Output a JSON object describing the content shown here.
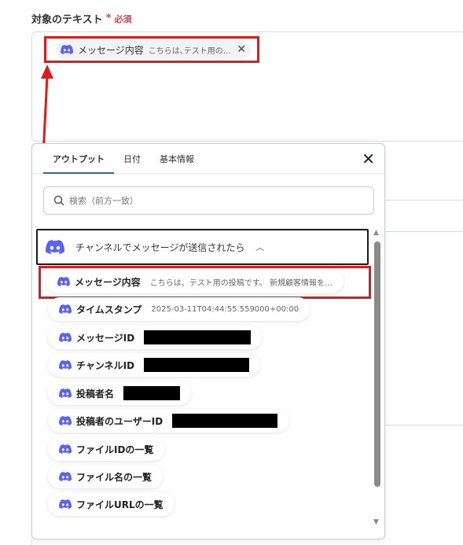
{
  "field": {
    "label": "対象のテキスト",
    "required_star": "*",
    "required_text": "必須"
  },
  "selected_chip": {
    "icon": "discord-icon",
    "name": "メッセージ内容",
    "preview": "こちらは､テスト用の…",
    "close": "✕"
  },
  "popup": {
    "tabs": [
      {
        "label": "アウトプット",
        "active": true
      },
      {
        "label": "日付",
        "active": false
      },
      {
        "label": "基本情報",
        "active": false
      }
    ],
    "close": "✕",
    "search": {
      "placeholder": "検索（前方一致）",
      "icon": "search-icon"
    },
    "group": {
      "label": "チャンネルでメッセージが送信されたら",
      "icon": "discord-icon",
      "chevron": "︿"
    },
    "items": [
      {
        "name": "メッセージ内容",
        "value": "こちらは、テスト用の投稿です。 新規顧客情報を…"
      },
      {
        "name": "タイムスタンプ",
        "value": "2025-03-11T04:44:55.559000+00:00"
      },
      {
        "name": "メッセージID",
        "value": ""
      },
      {
        "name": "チャンネルID",
        "value": ""
      },
      {
        "name": "投稿者名",
        "value": ""
      },
      {
        "name": "投稿者のユーザーID",
        "value": ""
      },
      {
        "name": "ファイルIDの一覧",
        "value": ""
      },
      {
        "name": "ファイル名の一覧",
        "value": ""
      },
      {
        "name": "ファイルURLの一覧",
        "value": ""
      }
    ]
  },
  "colors": {
    "discord": "#5865F2",
    "highlight_red": "#e01b1b",
    "required_red": "#e0424f",
    "tab_underline": "#2b6f8f"
  }
}
